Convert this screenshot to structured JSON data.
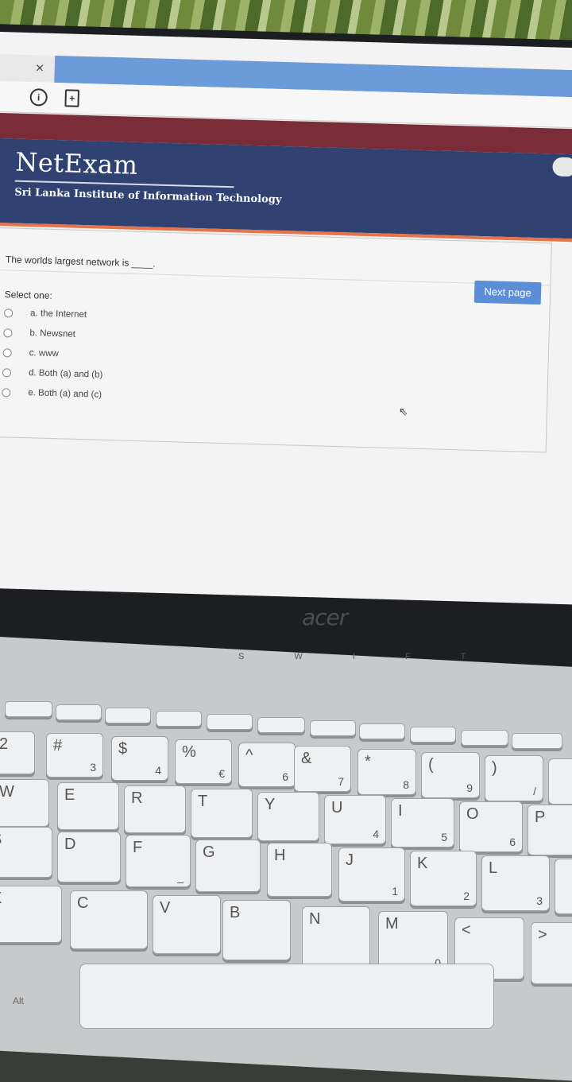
{
  "browser": {
    "close_glyph": "×",
    "info_glyph": "i",
    "page_glyph": "+"
  },
  "site": {
    "logo": "NetExam",
    "subtitle": "Sri Lanka Institute of Information Technology"
  },
  "question": {
    "text": "The worlds largest network is ____.",
    "prompt": "Select one:",
    "options": [
      {
        "label": "a. the Internet"
      },
      {
        "label": "b. Newsnet"
      },
      {
        "label": "c. www"
      },
      {
        "label": "d. Both (a) and (b)"
      },
      {
        "label": "e. Both (a) and (c)"
      }
    ]
  },
  "actions": {
    "next_label": "Next page"
  },
  "laptop": {
    "brand": "acer",
    "hinge_labels": "S W I F T"
  },
  "colors": {
    "header_bg": "#2f4272",
    "accent_stripe": "#7a2c38",
    "orange_rule": "#e6744b",
    "button": "#5b8ed7"
  }
}
